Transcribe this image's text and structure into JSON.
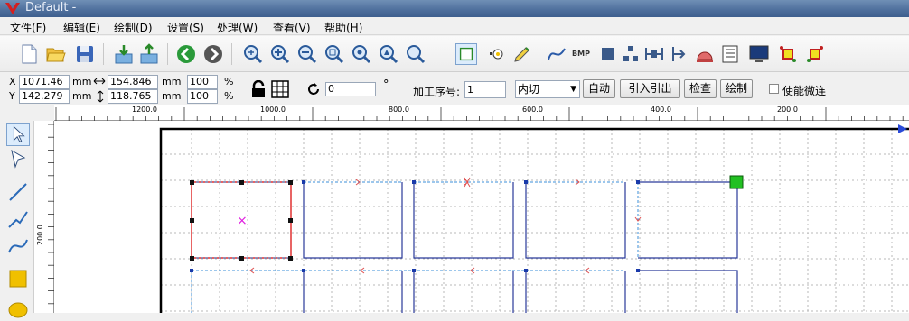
{
  "window": {
    "title": "Default -"
  },
  "menu": [
    {
      "label": "文件(F)"
    },
    {
      "label": "编辑(E)"
    },
    {
      "label": "绘制(D)"
    },
    {
      "label": "设置(S)"
    },
    {
      "label": "处理(W)"
    },
    {
      "label": "查看(V)"
    },
    {
      "label": "帮助(H)"
    }
  ],
  "toolbar": {
    "bmp_label": "BMP",
    "icons": [
      "new-file-icon",
      "open-folder-icon",
      "save-icon",
      "import-icon",
      "export-icon",
      "go-prev-icon",
      "go-next-icon",
      "zoom-icon",
      "zoom-in-icon",
      "zoom-out-icon",
      "zoom-window-icon",
      "zoom-all-icon",
      "zoom-selection-icon",
      "zoom-page-icon",
      "select-rect-icon",
      "node-edit-icon",
      "pen-icon",
      "curve-icon",
      "bmp-icon",
      "square-icon",
      "align-icon",
      "distribute-horizontal-icon",
      "align-left-icon",
      "laser-icon",
      "table-icon",
      "monitor-icon",
      "sort-icon",
      "path-optimize-icon"
    ]
  },
  "options": {
    "x_label": "X",
    "x_value": "1071.46",
    "x_unit": "mm",
    "y_label": "Y",
    "y_value": "142.279",
    "y_unit": "mm",
    "w_value": "154.846",
    "w_unit": "mm",
    "w_percent": "100",
    "w_pct_sign": "%",
    "h_value": "118.765",
    "h_unit": "mm",
    "h_percent": "100",
    "h_pct_sign": "%",
    "rotate_value": "0",
    "degree_sign": "°",
    "seq_label": "加工序号:",
    "seq_value": "1",
    "cut_mode": "内切",
    "auto_button": "自动",
    "lead_button": "引入引出",
    "check_button": "检查",
    "draw_button": "绘制",
    "micro_joint_label": "使能微连",
    "micro_joint_checked": false
  },
  "ruler": {
    "h_labels": [
      "1200.0",
      "1000.0",
      "800.0",
      "600.0",
      "400.0",
      "200.0"
    ],
    "v_labels": [
      "200.0"
    ]
  },
  "tools": [
    "select-arrow-icon",
    "node-select-icon",
    "line-icon",
    "polyline-icon",
    "bezier-icon",
    "rectangle-icon",
    "ellipse-icon"
  ],
  "colors": {
    "selected": "#e03030",
    "path": "#2a3a9a",
    "lead": "#3b8fd8",
    "start_marker": "#22c022",
    "origin_x": "#e020e0"
  }
}
